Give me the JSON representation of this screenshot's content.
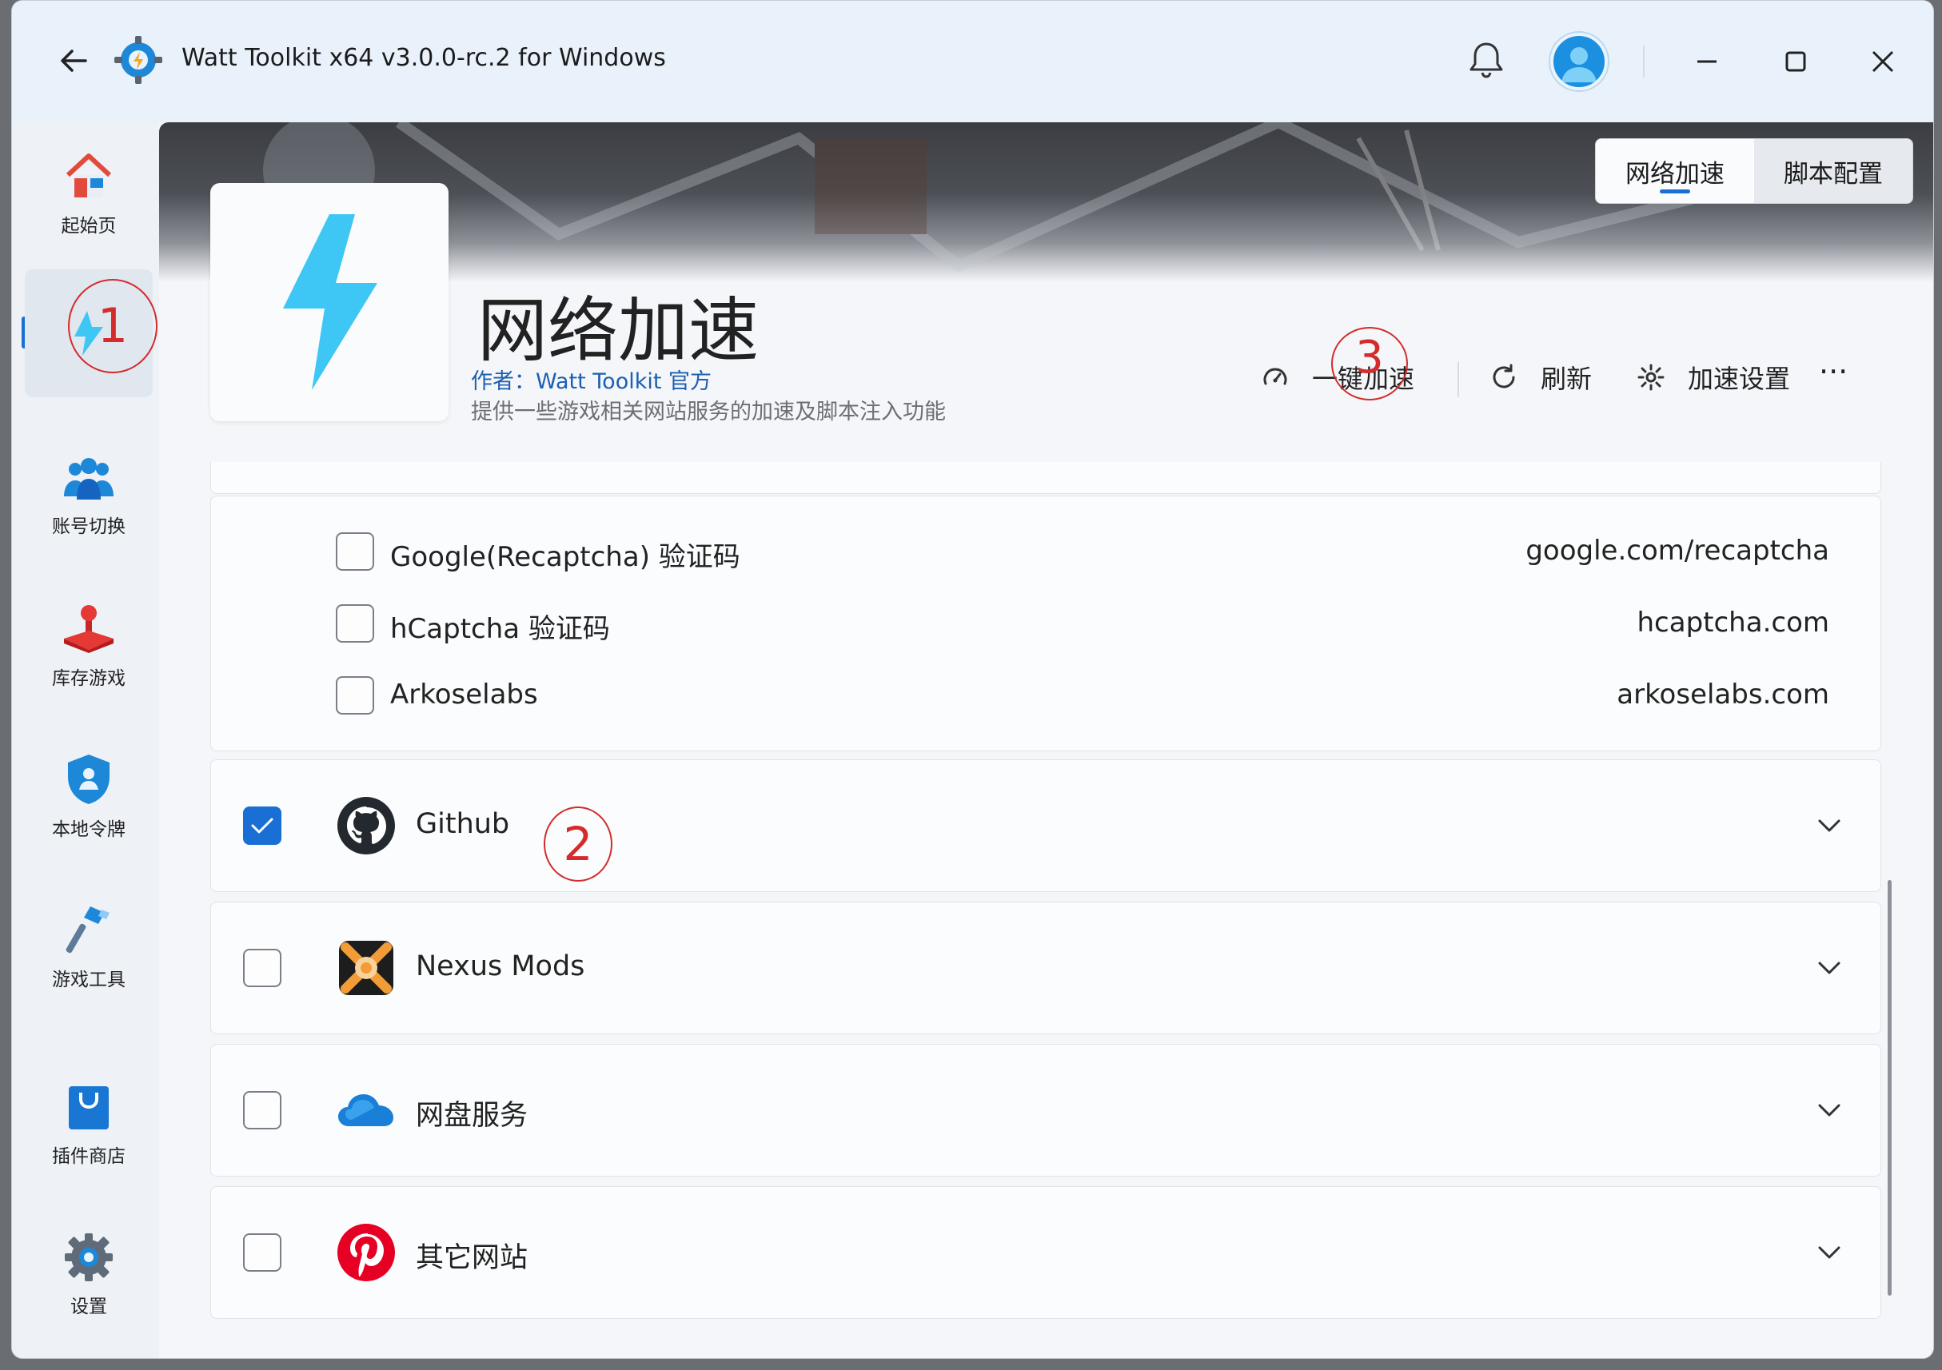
{
  "window": {
    "title": "Watt Toolkit x64 v3.0.0-rc.2 for Windows"
  },
  "sidebar": {
    "items": [
      {
        "label": "起始页",
        "icon": "home-icon"
      },
      {
        "label": "",
        "icon": "lightning-icon",
        "active": true
      },
      {
        "label": "账号切换",
        "icon": "users-icon"
      },
      {
        "label": "库存游戏",
        "icon": "joystick-icon"
      },
      {
        "label": "本地令牌",
        "icon": "shield-user-icon"
      },
      {
        "label": "游戏工具",
        "icon": "hammer-icon"
      },
      {
        "label": "插件商店",
        "icon": "store-bag-icon"
      },
      {
        "label": "设置",
        "icon": "gear-icon"
      }
    ]
  },
  "tabs": [
    {
      "label": "网络加速",
      "active": true
    },
    {
      "label": "脚本配置",
      "active": false
    }
  ],
  "header": {
    "title": "网络加速",
    "author": "作者：Watt Toolkit  官方",
    "description": "提供一些游戏相关网站服务的加速及脚本注入功能"
  },
  "toolbar": {
    "accelerate": "一键加速",
    "refresh": "刷新",
    "settings": "加速设置",
    "more": "···"
  },
  "sub_items": [
    {
      "name": "Google(Recaptcha) 验证码",
      "host": "google.com/recaptcha",
      "checked": false
    },
    {
      "name": "hCaptcha 验证码",
      "host": "hcaptcha.com",
      "checked": false
    },
    {
      "name": "Arkoselabs",
      "host": "arkoselabs.com",
      "checked": false
    }
  ],
  "groups": [
    {
      "name": "Github",
      "checked": true,
      "icon": "github-icon"
    },
    {
      "name": "Nexus Mods",
      "checked": false,
      "icon": "nexus-mods-icon"
    },
    {
      "name": "网盘服务",
      "checked": false,
      "icon": "cloud-icon"
    },
    {
      "name": "其它网站",
      "checked": false,
      "icon": "pinterest-icon"
    }
  ],
  "annotations": [
    "1",
    "2",
    "3"
  ],
  "colors": {
    "accent": "#1a6fd4",
    "annotation": "#d42b2b",
    "lightning": "#3ec6f5"
  }
}
